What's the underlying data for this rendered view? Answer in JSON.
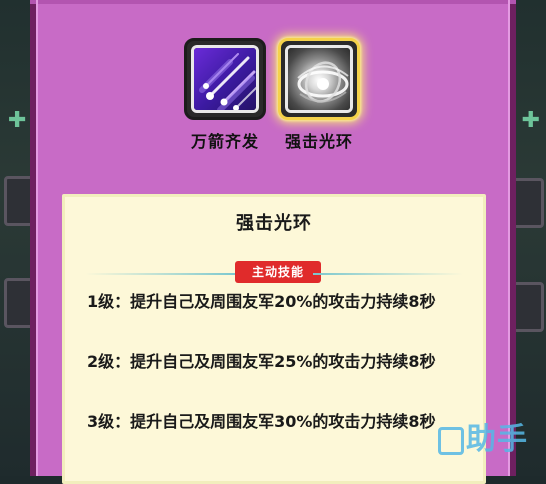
{
  "skills": [
    {
      "label": "万箭齐发",
      "icon": "arrow-volley-icon",
      "selected": false
    },
    {
      "label": "强击光环",
      "icon": "strike-aura-icon",
      "selected": true
    }
  ],
  "detail": {
    "title": "强击光环",
    "tag": "主动技能",
    "levels": [
      "1级：提升自己及周围友军20%的攻击力持续8秒",
      "2级：提升自己及周围友军25%的攻击力持续8秒",
      "3级：提升自己及周围友军30%的攻击力持续8秒"
    ]
  },
  "watermark": {
    "text": "助手"
  },
  "colors": {
    "panel": "#c86bc6",
    "panel_border": "#6e2060",
    "card": "#fdf8d8",
    "tag": "#e02b2b",
    "selected_glow": "#f5d24a",
    "watermark": "#56b8e6"
  }
}
